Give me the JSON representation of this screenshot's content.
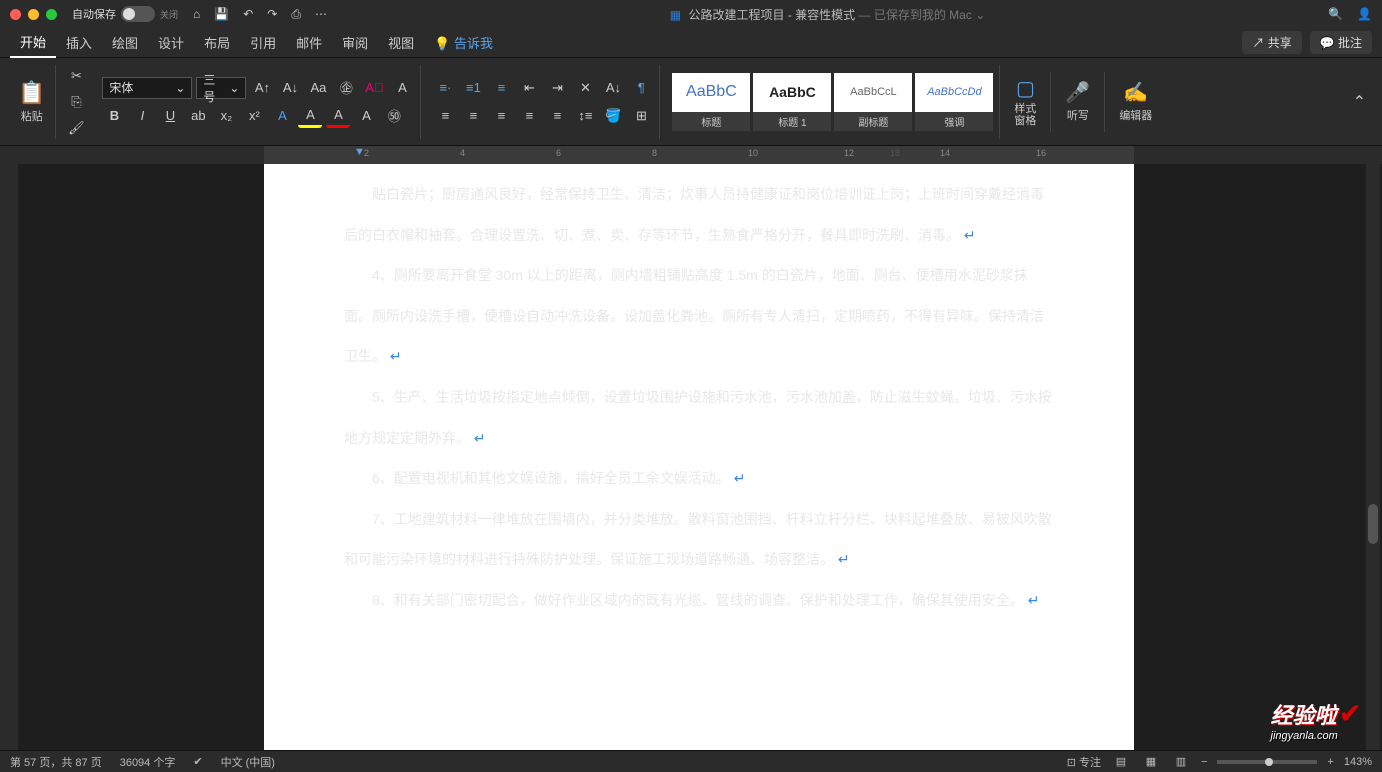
{
  "titlebar": {
    "autosave_label": "自动保存",
    "autosave_state": "关闭",
    "doc_name": "公路改建工程项目",
    "mode": " - 兼容性模式",
    "saved": " — 已保存到我的 Mac",
    "dropdown": "⌄"
  },
  "tabs": {
    "items": [
      "开始",
      "插入",
      "绘图",
      "设计",
      "布局",
      "引用",
      "邮件",
      "审阅",
      "视图"
    ],
    "tellme": "告诉我",
    "share": "共享",
    "comments": "批注"
  },
  "ribbon": {
    "paste": "粘贴",
    "font_name": "宋体",
    "font_size": "三号",
    "style1_preview": "AaBbC",
    "style1_name": "标题",
    "style2_preview": "AaBbC",
    "style2_name": "标题 1",
    "style3_preview": "AaBbCcL",
    "style3_name": "副标题",
    "style4_preview": "AaBbCcDd",
    "style4_name": "强调",
    "pane": "样式\n窗格",
    "dictate": "听写",
    "editor": "编辑器"
  },
  "ruler": {
    "ticks": [
      "2",
      "4",
      "6",
      "8",
      "10",
      "12",
      "14",
      "16"
    ],
    "right_ticks": [
      "18"
    ]
  },
  "document": {
    "p1": "贴白瓷片；厨房通风良好，经常保持卫生、清洁；炊事人员持健康证和岗位培训证上岗；上班时间穿戴经消毒后的白衣帽和袖套。合理设置洗、切、煮、卖、存等环节，生熟食严格分开，餐具即时洗刷、消毒。",
    "p2": "4、厕所要离开食堂 30m 以上的距离，厕内墙粗铺贴高度 1.5m 的白瓷片，地面、厕台、便槽用水泥砂浆抹面。厕所内设洗手槽，便槽设自动冲洗设备。设加盖化粪池。厕所有专人清扫，定期喷药，不得有异味。保持清洁卫生。",
    "p3": "5、生产、生活垃圾按指定地点倾倒，设置垃圾围护设施和污水池，污水池加盖，防止滋生蚊蝇。垃圾、污水按地方规定定期外弃。",
    "p4": "6、配置电视机和其他文娱设施，搞好全员工余文娱活动。",
    "p5": "7、工地建筑材料一律堆放在围墙内，并分类堆放。散料窗池围挡、杆料立杆分栏、块料起堆叠放、易被风吹散和可能污染环境的材料进行特殊防护处理。保证施工现场道路畅通、场容整洁。",
    "p6": "8、和有关部门密切配合，做好作业区域内的既有光缆、管线的调查、保护和处理工作，确保其使用安全。",
    "pmark": "↵"
  },
  "status": {
    "page": "第 57 页，共 87 页",
    "words": "36094 个字",
    "lang": "中文 (中国)",
    "focus": "专注",
    "zoom": "143%"
  },
  "watermark": {
    "text": "经验啦",
    "url": "jingyanla.com"
  }
}
